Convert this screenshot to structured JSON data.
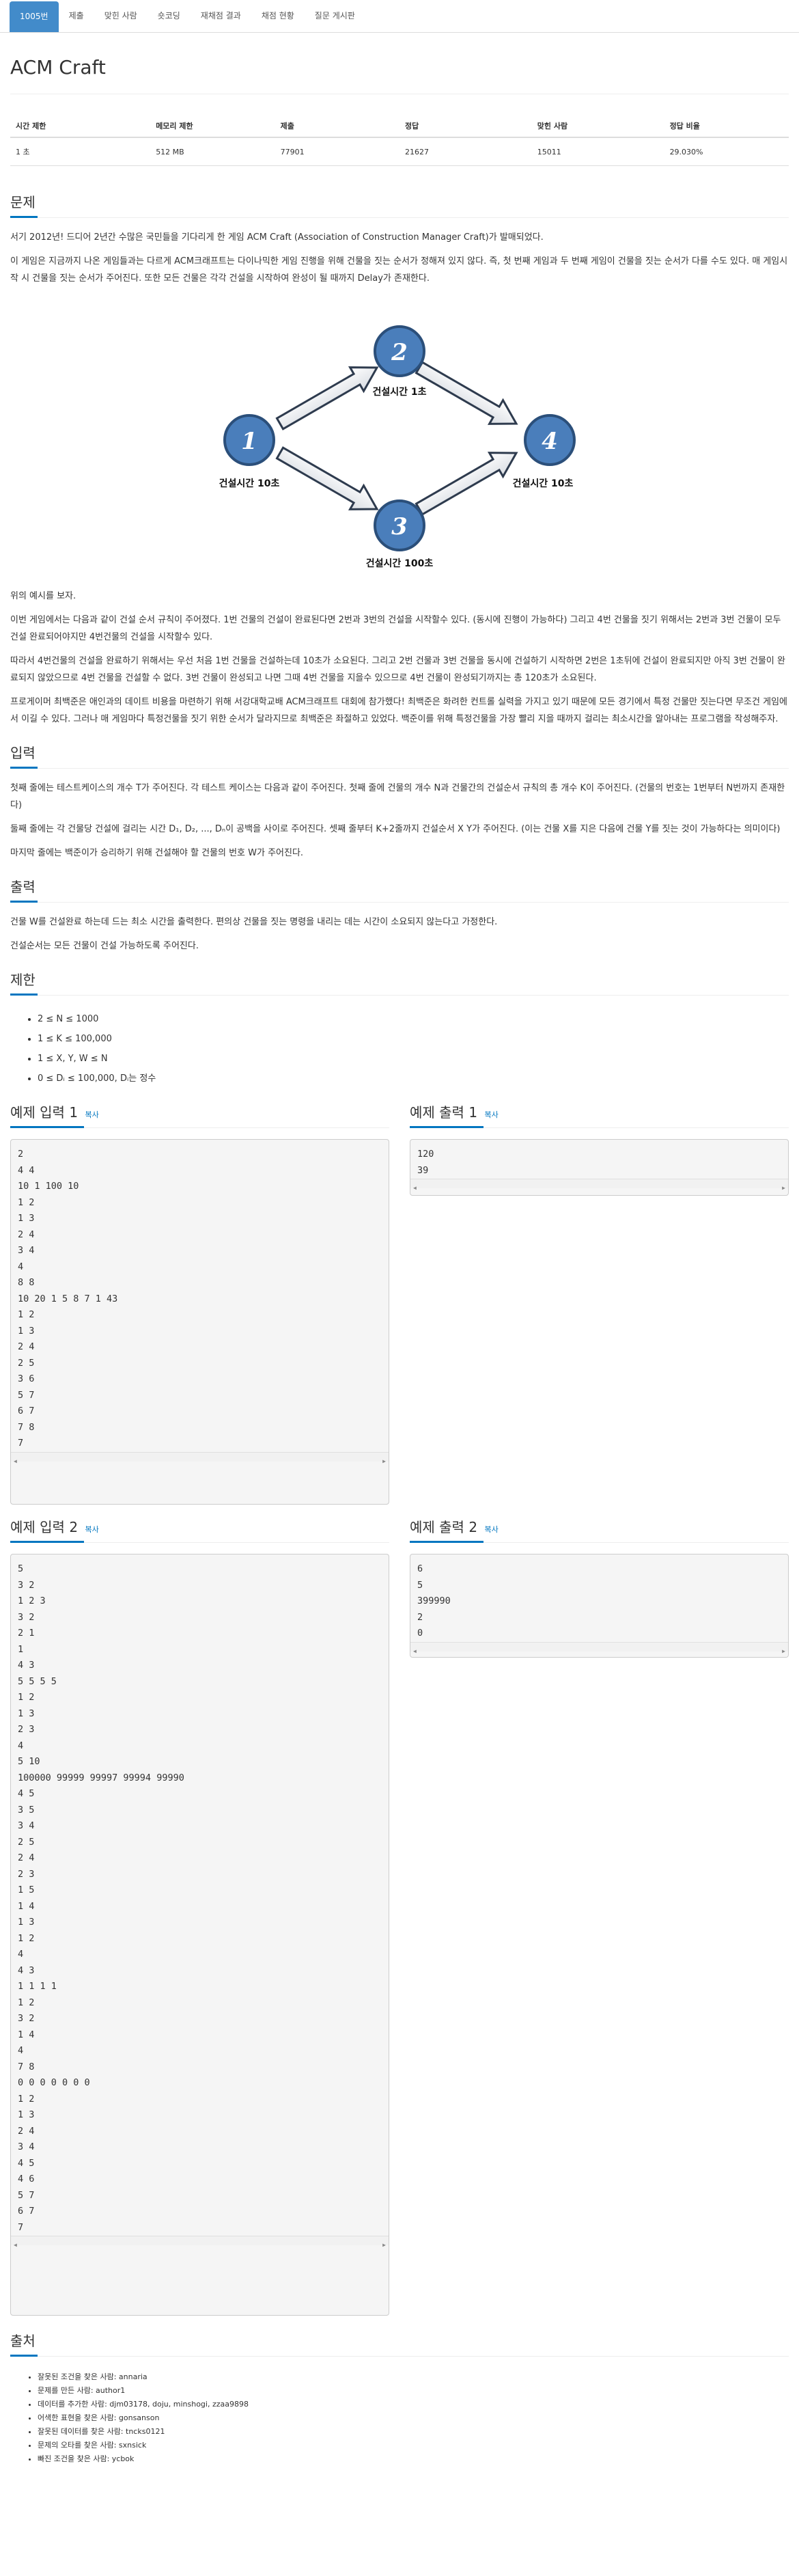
{
  "tabs": [
    "1005번",
    "제출",
    "맞힌 사람",
    "숏코딩",
    "재채점 결과",
    "채점 현황",
    "질문 게시판"
  ],
  "title": "ACM Craft",
  "info": {
    "headers": [
      "시간 제한",
      "메모리 제한",
      "제출",
      "정답",
      "맞힌 사람",
      "정답 비율"
    ],
    "values": [
      "1 초",
      "512 MB",
      "77901",
      "21627",
      "15011",
      "29.030%"
    ]
  },
  "sections": {
    "problem": "문제",
    "input": "입력",
    "output": "출력",
    "limits": "제한",
    "source": "출처"
  },
  "problem": {
    "p1": "서기 2012년! 드디어 2년간 수많은 국민들을 기다리게 한 게임 ACM Craft (Association of Construction Manager Craft)가 발매되었다.",
    "p2": "이 게임은 지금까지 나온 게임들과는 다르게 ACM크래프트는 다이나믹한 게임 진행을 위해 건물을 짓는 순서가 정해져 있지 않다. 즉, 첫 번째 게임과 두 번째 게임이 건물을 짓는 순서가 다를 수도 있다. 매 게임시작 시 건물을 짓는 순서가 주어진다. 또한 모든 건물은 각각 건설을 시작하여 완성이 될 때까지 Delay가 존재한다.",
    "p3": "위의 예시를 보자.",
    "p4": "이번 게임에서는 다음과 같이 건설 순서 규칙이 주어졌다. 1번 건물의 건설이 완료된다면 2번과 3번의 건설을 시작할수 있다. (동시에 진행이 가능하다) 그리고 4번 건물을 짓기 위해서는 2번과 3번 건물이 모두 건설 완료되어야지만 4번건물의 건설을 시작할수 있다.",
    "p5": "따라서 4번건물의 건설을 완료하기 위해서는 우선 처음 1번 건물을 건설하는데 10초가 소요된다. 그리고 2번 건물과 3번 건물을 동시에 건설하기 시작하면 2번은 1초뒤에 건설이 완료되지만 아직 3번 건물이 완료되지 않았으므로 4번 건물을 건설할 수 없다. 3번 건물이 완성되고 나면 그때 4번 건물을 지을수 있으므로 4번 건물이 완성되기까지는 총 120초가 소요된다.",
    "p6": "프로게이머 최백준은 애인과의 데이트 비용을 마련하기 위해 서강대학교배 ACM크래프트 대회에 참가했다! 최백준은 화려한 컨트롤 실력을 가지고 있기 때문에 모든 경기에서 특정 건물만 짓는다면 무조건 게임에서 이길 수 있다. 그러나 매 게임마다 특정건물을 짓기 위한 순서가 달라지므로 최백준은 좌절하고 있었다. 백준이를 위해 특정건물을 가장 빨리 지을 때까지 걸리는 최소시간을 알아내는 프로그램을 작성해주자."
  },
  "diagram": {
    "nodes": [
      "1",
      "2",
      "3",
      "4"
    ],
    "labels": [
      "건설시간 10초",
      "건설시간 1초",
      "건설시간 100초",
      "건설시간 10초"
    ]
  },
  "input": {
    "p1": "첫째 줄에는 테스트케이스의 개수 T가 주어진다. 각 테스트 케이스는 다음과 같이 주어진다. 첫째 줄에 건물의 개수 N과 건물간의 건설순서 규칙의 총 개수 K이 주어진다. (건물의 번호는 1번부터 N번까지 존재한다)",
    "p2": "둘째 줄에는 각 건물당 건설에 걸리는 시간 D₁, D₂, ..., Dₙ이 공백을 사이로 주어진다. 셋째 줄부터 K+2줄까지 건설순서 X Y가 주어진다. (이는 건물 X를 지은 다음에 건물 Y를 짓는 것이 가능하다는 의미이다)",
    "p3": "마지막 줄에는 백준이가 승리하기 위해 건설해야 할 건물의 번호 W가 주어진다."
  },
  "output": {
    "p1": "건물 W를 건설완료 하는데 드는 최소 시간을 출력한다. 편의상 건물을 짓는 명령을 내리는 데는 시간이 소요되지 않는다고 가정한다.",
    "p2": "건설순서는 모든 건물이 건설 가능하도록 주어진다."
  },
  "limits": [
    "2 ≤ N ≤ 1000",
    "1 ≤ K ≤ 100,000",
    "1 ≤ X, Y, W ≤ N",
    "0 ≤ Dᵢ ≤ 100,000, Dᵢ는 정수"
  ],
  "samples": {
    "copy_label": "복사",
    "in1_title": "예제 입력 1",
    "out1_title": "예제 출력 1",
    "in2_title": "예제 입력 2",
    "out2_title": "예제 출력 2",
    "in1": "2\n4 4\n10 1 100 10\n1 2\n1 3\n2 4\n3 4\n4\n8 8\n10 20 1 5 8 7 1 43\n1 2\n1 3\n2 4\n2 5\n3 6\n5 7\n6 7\n7 8\n7",
    "out1": "120\n39",
    "in2": "5\n3 2\n1 2 3\n3 2\n2 1\n1\n4 3\n5 5 5 5\n1 2\n1 3\n2 3\n4\n5 10\n100000 99999 99997 99994 99990\n4 5\n3 5\n3 4\n2 5\n2 4\n2 3\n1 5\n1 4\n1 3\n1 2\n4\n4 3\n1 1 1 1\n1 2\n3 2\n1 4\n4\n7 8\n0 0 0 0 0 0 0\n1 2\n1 3\n2 4\n3 4\n4 5\n4 6\n5 7\n6 7\n7",
    "out2": "6\n5\n399990\n2\n0"
  },
  "source": [
    "잘못된 조건을 찾은 사람: annaria",
    "문제를 만든 사람: author1",
    "데이터를 추가한 사람: djm03178, doju, minshogi, zzaa9898",
    "어색한 표현을 찾은 사람: gonsanson",
    "잘못된 데이터를 찾은 사람: tncks0121",
    "문제의 오타를 찾은 사람: sxnsick",
    "빠진 조건을 찾은 사람: ycbok"
  ],
  "colors": {
    "accent": "#0076c0",
    "tab_active": "#428bca",
    "node_fill": "#4a7ebb",
    "node_stroke": "#2b4f7a"
  }
}
